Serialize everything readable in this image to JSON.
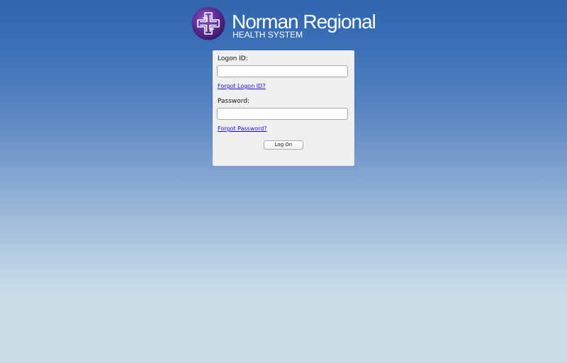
{
  "brand": {
    "name": "Norman Regional",
    "subtitle": "HEALTH SYSTEM",
    "logo_icon": "norman-regional-cross-logo",
    "colors": {
      "logo_purple": "#5a2d91",
      "header_blue": "#2f66b0",
      "background_bottom": "#cadde7"
    }
  },
  "login": {
    "logon_id_label": "Logon ID:",
    "logon_id_value": "",
    "forgot_logon_link": "Forgot Logon ID?",
    "password_label": "Password:",
    "password_value": "",
    "forgot_password_link": "Forgot Password?",
    "submit_label": "Log On",
    "link_color": "#1a0dcc"
  }
}
